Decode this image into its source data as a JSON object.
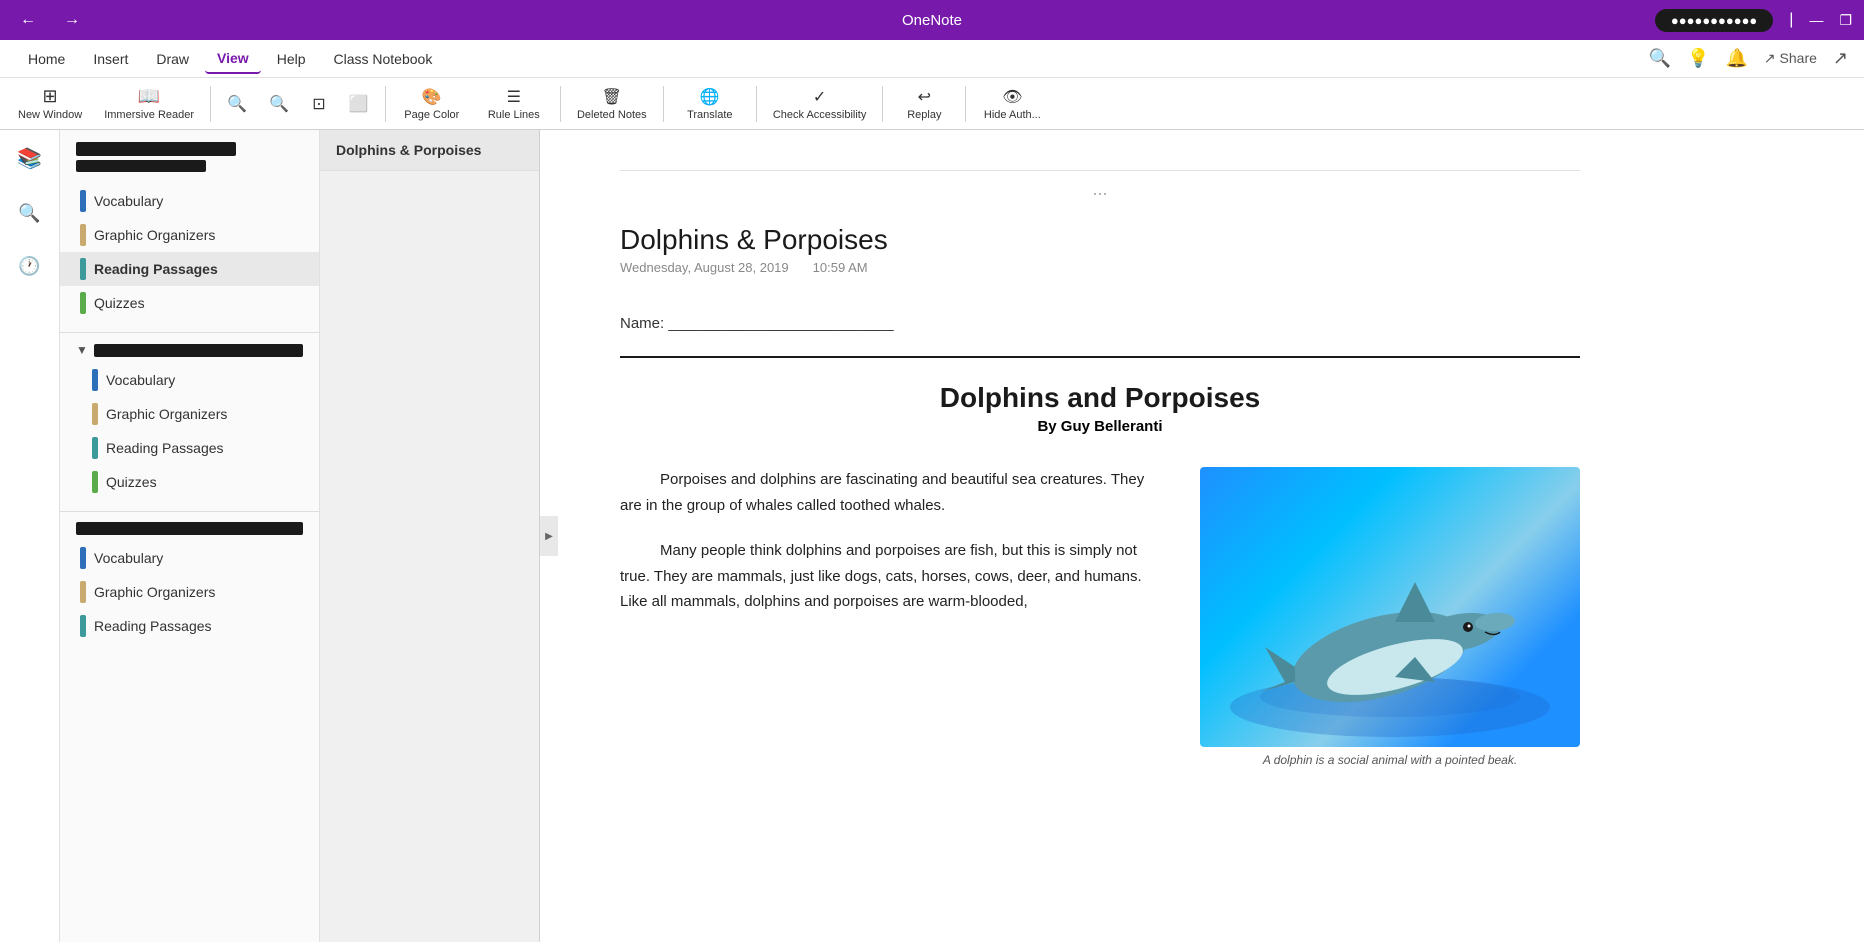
{
  "titleBar": {
    "title": "OneNote",
    "backBtn": "←",
    "forwardBtn": "→",
    "profileText": "●●●●●●●●●●●",
    "minimize": "—",
    "restore": "❐",
    "separator": "|"
  },
  "menuBar": {
    "items": [
      {
        "label": "Home",
        "active": false
      },
      {
        "label": "Insert",
        "active": false
      },
      {
        "label": "Draw",
        "active": false
      },
      {
        "label": "View",
        "active": true
      },
      {
        "label": "Help",
        "active": false
      },
      {
        "label": "Class Notebook",
        "active": false
      }
    ],
    "rightIcons": [
      "🔍",
      "💡",
      "🔔",
      "Share",
      "↗"
    ]
  },
  "ribbon": {
    "buttons": [
      {
        "icon": "⊞",
        "label": "New Window"
      },
      {
        "icon": "📖",
        "label": "Immersive Reader"
      },
      {
        "icon": "🔍-",
        "label": ""
      },
      {
        "icon": "🔍+",
        "label": ""
      },
      {
        "icon": "⊡",
        "label": ""
      },
      {
        "icon": "⬜",
        "label": ""
      },
      {
        "icon": "🎨",
        "label": "Page Color"
      },
      {
        "icon": "≡",
        "label": "Rule Lines"
      },
      {
        "icon": "🗑",
        "label": "Deleted Notes"
      },
      {
        "icon": "🌐",
        "label": "Translate"
      },
      {
        "icon": "✓",
        "label": "Check Accessibility"
      },
      {
        "icon": "↩",
        "label": "Replay"
      },
      {
        "icon": "👁",
        "label": "Hide Auth..."
      }
    ]
  },
  "sidebar": {
    "icons": [
      {
        "name": "library",
        "glyph": "📚"
      },
      {
        "name": "search",
        "glyph": "🔍"
      },
      {
        "name": "recent",
        "glyph": "🕐"
      }
    ]
  },
  "notebookPanel": {
    "notebookName1": "████████████",
    "notebookName2": "██████████",
    "sections": [
      {
        "label": "Vocabulary",
        "color": "blue",
        "dot": "dot-blue"
      },
      {
        "label": "Graphic Organizers",
        "color": "tan",
        "dot": "dot-tan"
      },
      {
        "label": "Reading Passages",
        "color": "teal",
        "dot": "dot-teal",
        "active": true
      },
      {
        "label": "Quizzes",
        "color": "green",
        "dot": "dot-green"
      }
    ],
    "group1": {
      "collapsed": false,
      "sections": [
        {
          "label": "Vocabulary",
          "color": "blue",
          "dot": "dot-blue"
        },
        {
          "label": "Graphic Organizers",
          "color": "tan",
          "dot": "dot-tan"
        },
        {
          "label": "Reading Passages",
          "color": "teal",
          "dot": "dot-teal"
        },
        {
          "label": "Quizzes",
          "color": "green",
          "dot": "dot-green"
        }
      ]
    },
    "group2": {
      "sections": [
        {
          "label": "Vocabulary",
          "color": "blue",
          "dot": "dot-blue"
        },
        {
          "label": "Graphic Organizers",
          "color": "tan",
          "dot": "dot-tan"
        },
        {
          "label": "Reading Passages",
          "color": "teal",
          "dot": "dot-teal"
        }
      ]
    }
  },
  "pageList": {
    "pages": [
      {
        "label": "Dolphins & Porpoises",
        "active": true
      }
    ]
  },
  "content": {
    "pageTitle": "Dolphins & Porpoises",
    "pageDate": "Wednesday, August 28, 2019",
    "pageTime": "10:59 AM",
    "dotsLabel": "...",
    "nameLine": "Name: ___________________________",
    "articleTitle": "Dolphins and Porpoises",
    "articleAuthor": "By Guy Belleranti",
    "paragraph1": "Porpoises and dolphins are fascinating and beautiful sea creatures.  They are in the group of whales called toothed whales.",
    "paragraph2": "Many people think dolphins and porpoises are fish, but this is simply not true. They are mammals, just like dogs, cats, horses, cows, deer, and humans.  Like all mammals, dolphins and porpoises are warm-blooded,",
    "imageCaption": "A dolphin is a social animal with a pointed beak."
  }
}
